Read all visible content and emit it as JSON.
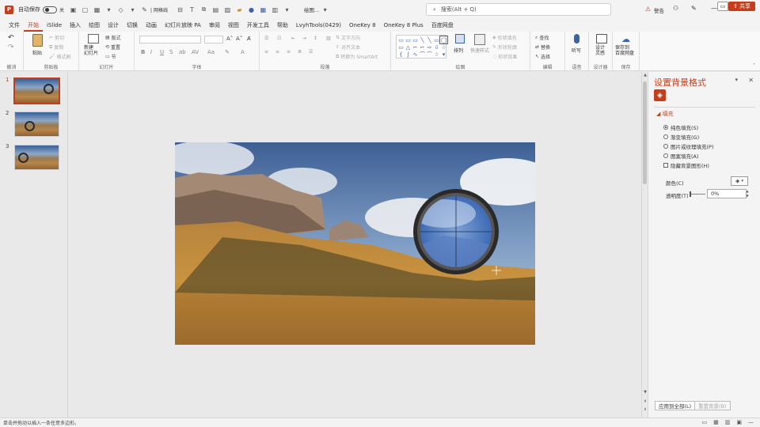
{
  "titlebar": {
    "autosave_label": "自动保存",
    "autosave_state": "关",
    "tools_text": "| 网格线",
    "doc_title": "绘图...",
    "search_placeholder": "搜索(Alt + Q)",
    "warning_label": "警告"
  },
  "menu": {
    "tabs": [
      "文件",
      "开始",
      "iSlide",
      "插入",
      "绘图",
      "设计",
      "切换",
      "动画",
      "幻灯片放映 PA",
      "审阅",
      "视图",
      "开发工具",
      "帮助",
      "LvyhTools(0429)",
      "OneKey 8",
      "OneKey 8 Plus",
      "百度网盘"
    ],
    "active_index": 1,
    "share_label": "共享"
  },
  "ribbon": {
    "groups": [
      {
        "label": "撤消"
      },
      {
        "label": "剪贴板"
      },
      {
        "label": "幻灯片"
      },
      {
        "label": "字体"
      },
      {
        "label": "段落"
      },
      {
        "label": "绘图"
      },
      {
        "label": "编辑"
      },
      {
        "label": "语音"
      },
      {
        "label": "设计器"
      },
      {
        "label": "保存"
      }
    ],
    "paste_label": "粘贴",
    "cut_label": "剪切",
    "copy_label": "复制",
    "format_painter_label": "格式刷",
    "new_slide_label": "新建\n幻灯片",
    "layout_label": "版式",
    "reset_label": "重置",
    "section_label": "节",
    "text_direction_label": "文字方向",
    "align_text_label": "对齐文本",
    "smartart_label": "转换为 SmartArt",
    "arrange_label": "排列",
    "quick_styles_label": "快速样式",
    "shape_fill_label": "形状填充",
    "shape_outline_label": "形状轮廓",
    "shape_effects_label": "形状效果",
    "find_label": "查找",
    "replace_label": "替换",
    "select_label": "选择",
    "dictate_label": "听写",
    "designer_label": "设计\n灵感",
    "save_baidu_label": "保存到\n百度网盘"
  },
  "slides": [
    {
      "number": "1",
      "active": true
    },
    {
      "number": "2",
      "active": false
    },
    {
      "number": "3",
      "active": false
    }
  ],
  "format_pane": {
    "title": "设置背景格式",
    "section": "填充",
    "options": [
      {
        "label": "纯色填充(S)",
        "selected": true
      },
      {
        "label": "渐变填充(G)",
        "selected": false
      },
      {
        "label": "图片或纹理填充(P)",
        "selected": false
      },
      {
        "label": "图案填充(A)",
        "selected": false
      }
    ],
    "hide_graphics_label": "隐藏背景图形(H)",
    "color_label": "颜色(C)",
    "transparency_label": "透明度(T)",
    "transparency_value": "0%",
    "apply_all_label": "应用到全部(L)",
    "reset_label": "重置背景(B)"
  },
  "status": {
    "text": "单击并拖动以插入一条任意多边形。"
  },
  "colors": {
    "accent": "#c43e1c",
    "background": "#e9e9e9"
  }
}
